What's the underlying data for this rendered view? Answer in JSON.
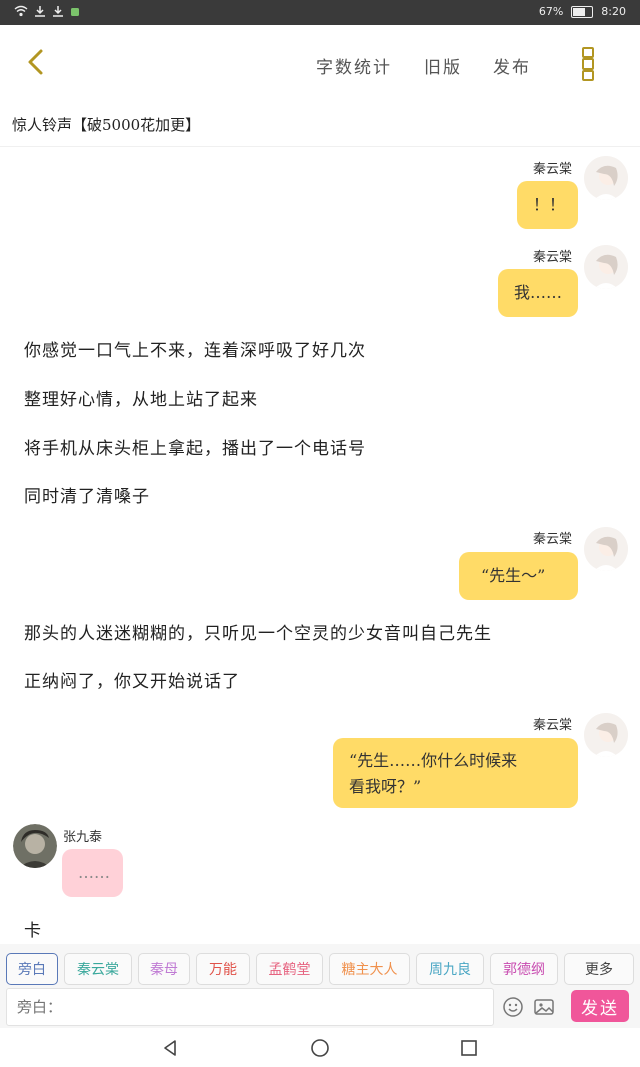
{
  "status_bar": {
    "battery": "67%",
    "time": "8:20"
  },
  "top_menu": {
    "word_count": "字数统计",
    "old_version": "旧版",
    "publish": "发布"
  },
  "chapter_title": "惊人铃声【破5000花加更】",
  "messages": [
    {
      "speaker": "秦云棠",
      "text": "！！"
    },
    {
      "speaker": "秦云棠",
      "text": "我……"
    },
    {
      "narration": "你感觉一口气上不来，连着深呼吸了好几次"
    },
    {
      "narration": "整理好心情，从地上站了起来"
    },
    {
      "narration": "将手机从床头柜上拿起，播出了一个电话号"
    },
    {
      "narration": "同时清了清嗓子"
    },
    {
      "speaker": "秦云棠",
      "text": "“先生～”"
    },
    {
      "narration": "那头的人迷迷糊糊的，只听见一个空灵的少女音叫自己先生"
    },
    {
      "narration": "正纳闷了，你又开始说话了"
    },
    {
      "speaker": "秦云棠",
      "text_line1": "“先生……你什么时候来",
      "text_line2": "看我呀？”"
    },
    {
      "speaker": "张九泰",
      "text": "……"
    },
    {
      "narration": "卡"
    }
  ],
  "roles": [
    "旁白",
    "秦云棠",
    "秦母",
    "万能",
    "孟鹤堂",
    "糖主大人",
    "周九良",
    "郭德纲",
    "更多"
  ],
  "role_colors": [
    "#5a79b8",
    "#3aa89c",
    "#c07bd4",
    "#e0534a",
    "#e6627f",
    "#f0914d",
    "#4ba7c4",
    "#c84bb0",
    "#444444"
  ],
  "input": {
    "placeholder": "旁白："
  },
  "send_label": "发送"
}
